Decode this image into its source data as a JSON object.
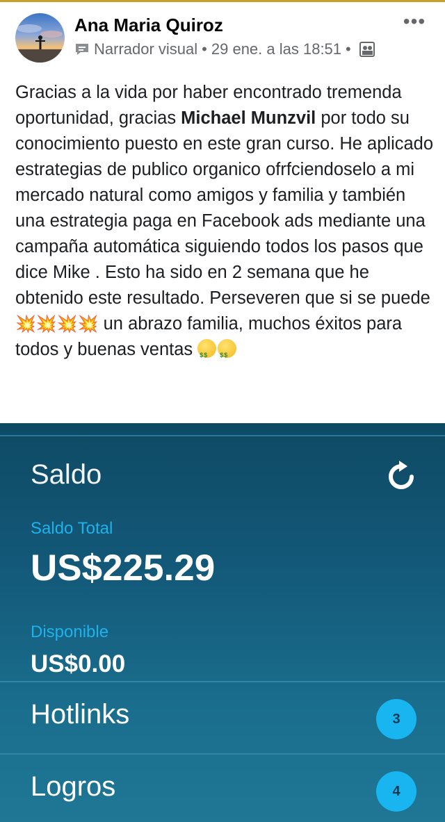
{
  "post": {
    "author": "Ana Maria Quiroz",
    "badge": "Narrador visual",
    "separator": "•",
    "timestamp": "29 ene. a las 18:51",
    "more_label": "•••",
    "body": {
      "part1": "Gracias a la vida por haber encontrado tremenda oportunidad, gracias ",
      "mention": "Michael Munzvil",
      "part2": " por todo su conocimiento puesto en este gran curso. He aplicado estrategias de publico organico ofrfciendoselo a mi mercado natural como amigos y familia y también una estrategia paga en Facebook ads mediante una campaña automática siguiendo todos los pasos que dice Mike . Esto ha sido en 2 semana que he obtenido este resultado. Perseveren que si se puede ",
      "emoji_boom": "💥💥💥💥",
      "part3": " un abrazo familia, muchos éxitos para todos y buenas ventas "
    }
  },
  "panel": {
    "title": "Saldo",
    "total_label": "Saldo Total",
    "total_value": "US$225.29",
    "available_label": "Disponible",
    "available_value": "US$0.00",
    "rows": [
      {
        "label": "Hotlinks",
        "count": "3"
      },
      {
        "label": "Logros",
        "count": "4"
      }
    ]
  },
  "colors": {
    "accent_blue": "#19b5f0",
    "panel_dark": "#0e4a64",
    "text_muted": "#65676b"
  },
  "icons": {
    "more": "more-horizontal-icon",
    "badge": "speech-bubble-icon",
    "privacy": "friends-icon",
    "refresh": "refresh-icon"
  }
}
